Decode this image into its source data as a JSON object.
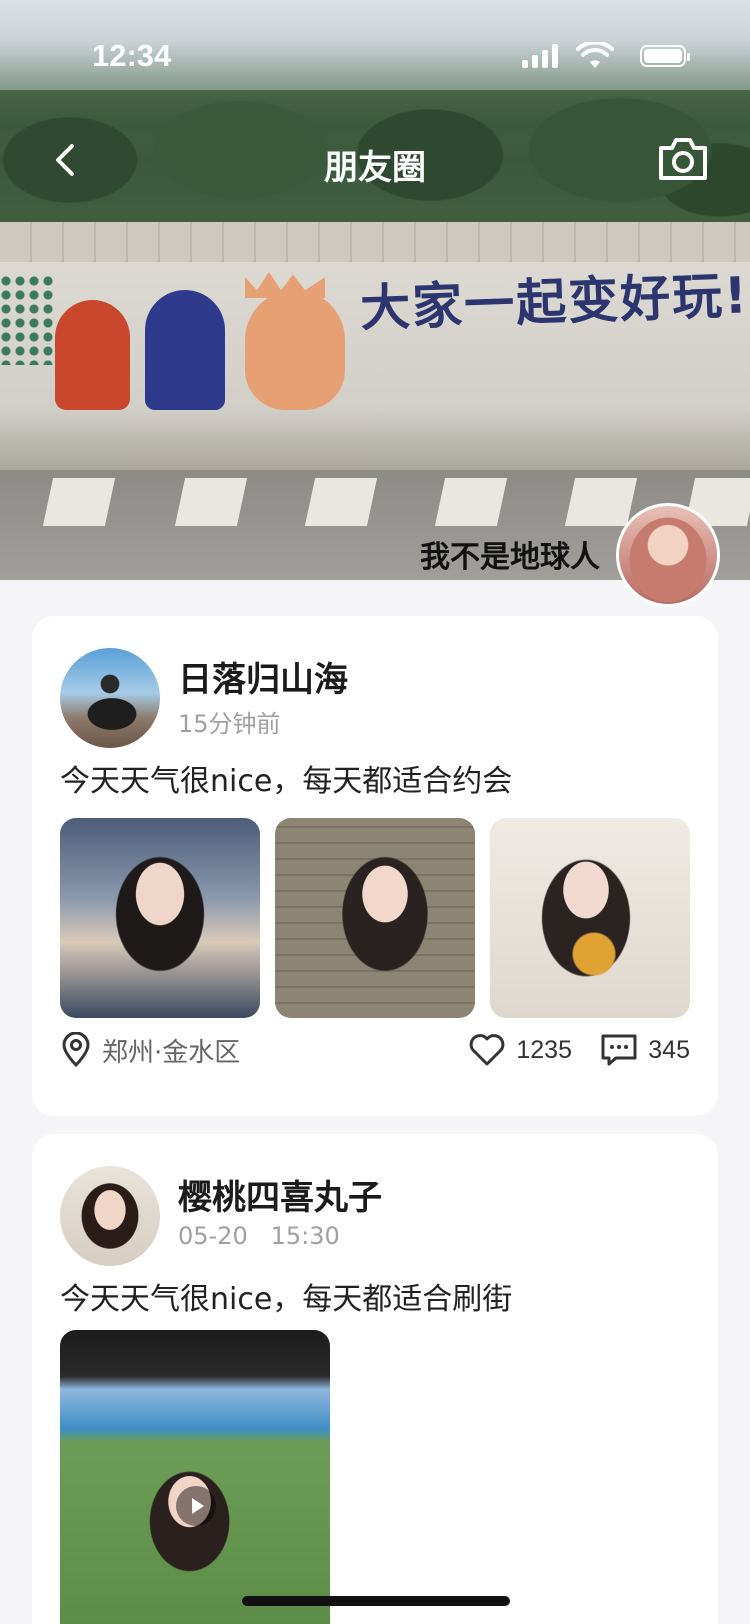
{
  "status_bar": {
    "time": "12:34"
  },
  "nav": {
    "title": "朋友圈",
    "back_icon": "chevron-left-icon",
    "camera_icon": "camera-icon"
  },
  "cover": {
    "graffiti_text": "大家一起变好玩!"
  },
  "profile": {
    "name": "我不是地球人"
  },
  "posts": [
    {
      "username": "日落归山海",
      "time": "15分钟前",
      "text": "今天天气很nice，每天都适合约会",
      "location": "郑州·金水区",
      "likes": "1235",
      "comments": "345"
    },
    {
      "username": "樱桃四喜丸子",
      "time": "05-20   15:30",
      "text": "今天天气很nice，每天都适合刷街"
    }
  ],
  "colors": {
    "page_bg": "#f5f5f7",
    "card_bg": "#ffffff",
    "muted_text": "#a0a0a0"
  }
}
